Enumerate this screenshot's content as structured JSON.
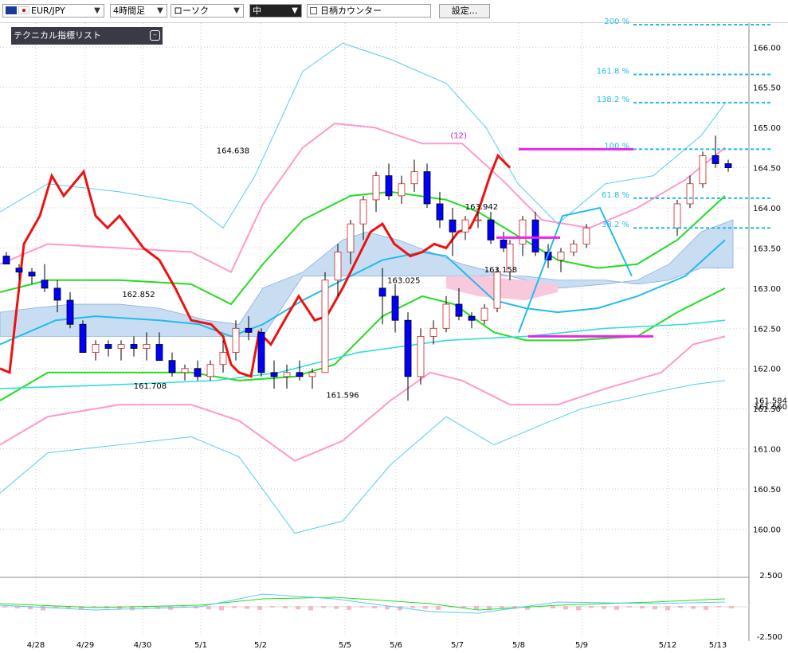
{
  "toolbar": {
    "symbol": "EUR/JPY",
    "timeframe": "4時間足",
    "chart_style": "ローソク",
    "size": "中",
    "counter_label": "日柄カウンター",
    "settings_label": "設定..."
  },
  "indicator_panel": {
    "title": "テクニカル指標リスト"
  },
  "colors": {
    "candle_up": "#ffffff",
    "candle_down": "#0000ff",
    "ichimoku_cloud": "#c8dcf2",
    "ichimoku_cloud_bear": "#f8c8dc",
    "bb_outer": "#55ccf0",
    "bb_mid": "#ff99cc",
    "bb_inner": "#22dd22",
    "rsi_red": "#ee1111",
    "ma_cyan": "#22bbee",
    "fib_line": "#22bbee",
    "trendline_magenta": "#ee22ee"
  },
  "chart_data": {
    "type": "candlestick",
    "y_range": [
      159.4,
      166.3
    ],
    "x_labels": [
      "4/28",
      "4/29",
      "4/30",
      "5/1",
      "5/2",
      "5/5",
      "5/6",
      "5/7",
      "5/8",
      "5/9",
      "5/12",
      "5/13"
    ],
    "y_ticks": [
      "166.00",
      "165.50",
      "165.00",
      "164.50",
      "164.00",
      "163.50",
      "163.00",
      "162.50",
      "162.00",
      "161.50",
      "161.00",
      "160.50",
      "160.00"
    ],
    "y_tick_values": [
      166.0,
      165.5,
      165.0,
      164.5,
      164.0,
      163.5,
      163.0,
      162.5,
      162.0,
      161.5,
      161.0,
      160.5,
      160.0
    ],
    "annotations": [
      {
        "text": "164.638",
        "x": 17.9,
        "y": 164.638
      },
      {
        "text": "162.852",
        "x": 10.5,
        "y": 162.852
      },
      {
        "text": "161.708",
        "x": 11.4,
        "y": 161.708
      },
      {
        "text": "161.596",
        "x": 26.5,
        "y": 161.596
      },
      {
        "text": "163.025",
        "x": 31.3,
        "y": 163.025
      },
      {
        "text": "163.942",
        "x": 37.4,
        "y": 163.942
      },
      {
        "text": "163.158",
        "x": 38.9,
        "y": 163.158
      },
      {
        "text": "(12)",
        "x": 35.6,
        "y": 164.83
      }
    ],
    "fib_levels": [
      {
        "label": "200 %",
        "value": 166.28
      },
      {
        "label": "161.8 %",
        "value": 165.66
      },
      {
        "label": "138.2 %",
        "value": 165.31
      },
      {
        "label": "100 %",
        "value": 164.73
      },
      {
        "label": "61.8 %",
        "value": 164.12
      },
      {
        "label": "38.2 %",
        "value": 163.75
      }
    ],
    "last_price_labels": [
      "161.584",
      "161.560"
    ],
    "candles": [
      [
        163.4,
        163.45,
        163.3,
        163.3
      ],
      [
        163.25,
        163.3,
        163.1,
        163.2
      ],
      [
        163.2,
        163.25,
        163.05,
        163.15
      ],
      [
        163.1,
        163.3,
        162.95,
        163.0
      ],
      [
        163.0,
        163.1,
        162.7,
        162.85
      ],
      [
        162.85,
        162.95,
        162.5,
        162.55
      ],
      [
        162.55,
        162.6,
        162.2,
        162.2
      ],
      [
        162.2,
        162.35,
        162.1,
        162.3
      ],
      [
        162.3,
        162.35,
        162.15,
        162.25
      ],
      [
        162.25,
        162.35,
        162.1,
        162.3
      ],
      [
        162.3,
        162.4,
        162.15,
        162.25
      ],
      [
        162.25,
        162.45,
        162.1,
        162.3
      ],
      [
        162.3,
        162.45,
        162.1,
        162.1
      ],
      [
        162.1,
        162.2,
        161.9,
        161.95
      ],
      [
        161.95,
        162.05,
        161.85,
        162.0
      ],
      [
        162.0,
        162.1,
        161.85,
        161.9
      ],
      [
        161.9,
        162.1,
        161.85,
        162.05
      ],
      [
        162.05,
        162.35,
        161.95,
        162.2
      ],
      [
        162.2,
        162.6,
        162.1,
        162.5
      ],
      [
        162.5,
        162.65,
        162.35,
        162.45
      ],
      [
        162.45,
        162.5,
        161.9,
        161.95
      ],
      [
        161.95,
        162.1,
        161.75,
        161.9
      ],
      [
        161.9,
        162.05,
        161.75,
        161.95
      ],
      [
        161.95,
        162.1,
        161.85,
        161.9
      ],
      [
        161.9,
        162.0,
        161.75,
        161.95
      ],
      [
        161.95,
        163.2,
        161.95,
        163.1
      ],
      [
        163.1,
        163.55,
        162.9,
        163.45
      ],
      [
        163.45,
        163.85,
        163.3,
        163.8
      ],
      [
        163.8,
        164.15,
        163.6,
        164.1
      ],
      [
        164.1,
        164.45,
        163.95,
        164.4
      ],
      [
        164.4,
        164.55,
        164.1,
        164.15
      ],
      [
        164.15,
        164.4,
        164.05,
        164.3
      ],
      [
        164.3,
        164.6,
        164.2,
        164.45
      ],
      [
        164.45,
        164.55,
        164.0,
        164.05
      ],
      [
        164.05,
        164.2,
        163.75,
        163.85
      ],
      [
        163.85,
        164.0,
        163.4,
        163.7
      ],
      [
        163.7,
        163.9,
        163.6,
        163.85
      ],
      [
        163.85,
        163.95,
        163.75,
        163.85
      ],
      [
        163.85,
        163.95,
        163.55,
        163.6
      ],
      [
        163.6,
        163.7,
        163.45,
        163.5
      ]
    ]
  }
}
